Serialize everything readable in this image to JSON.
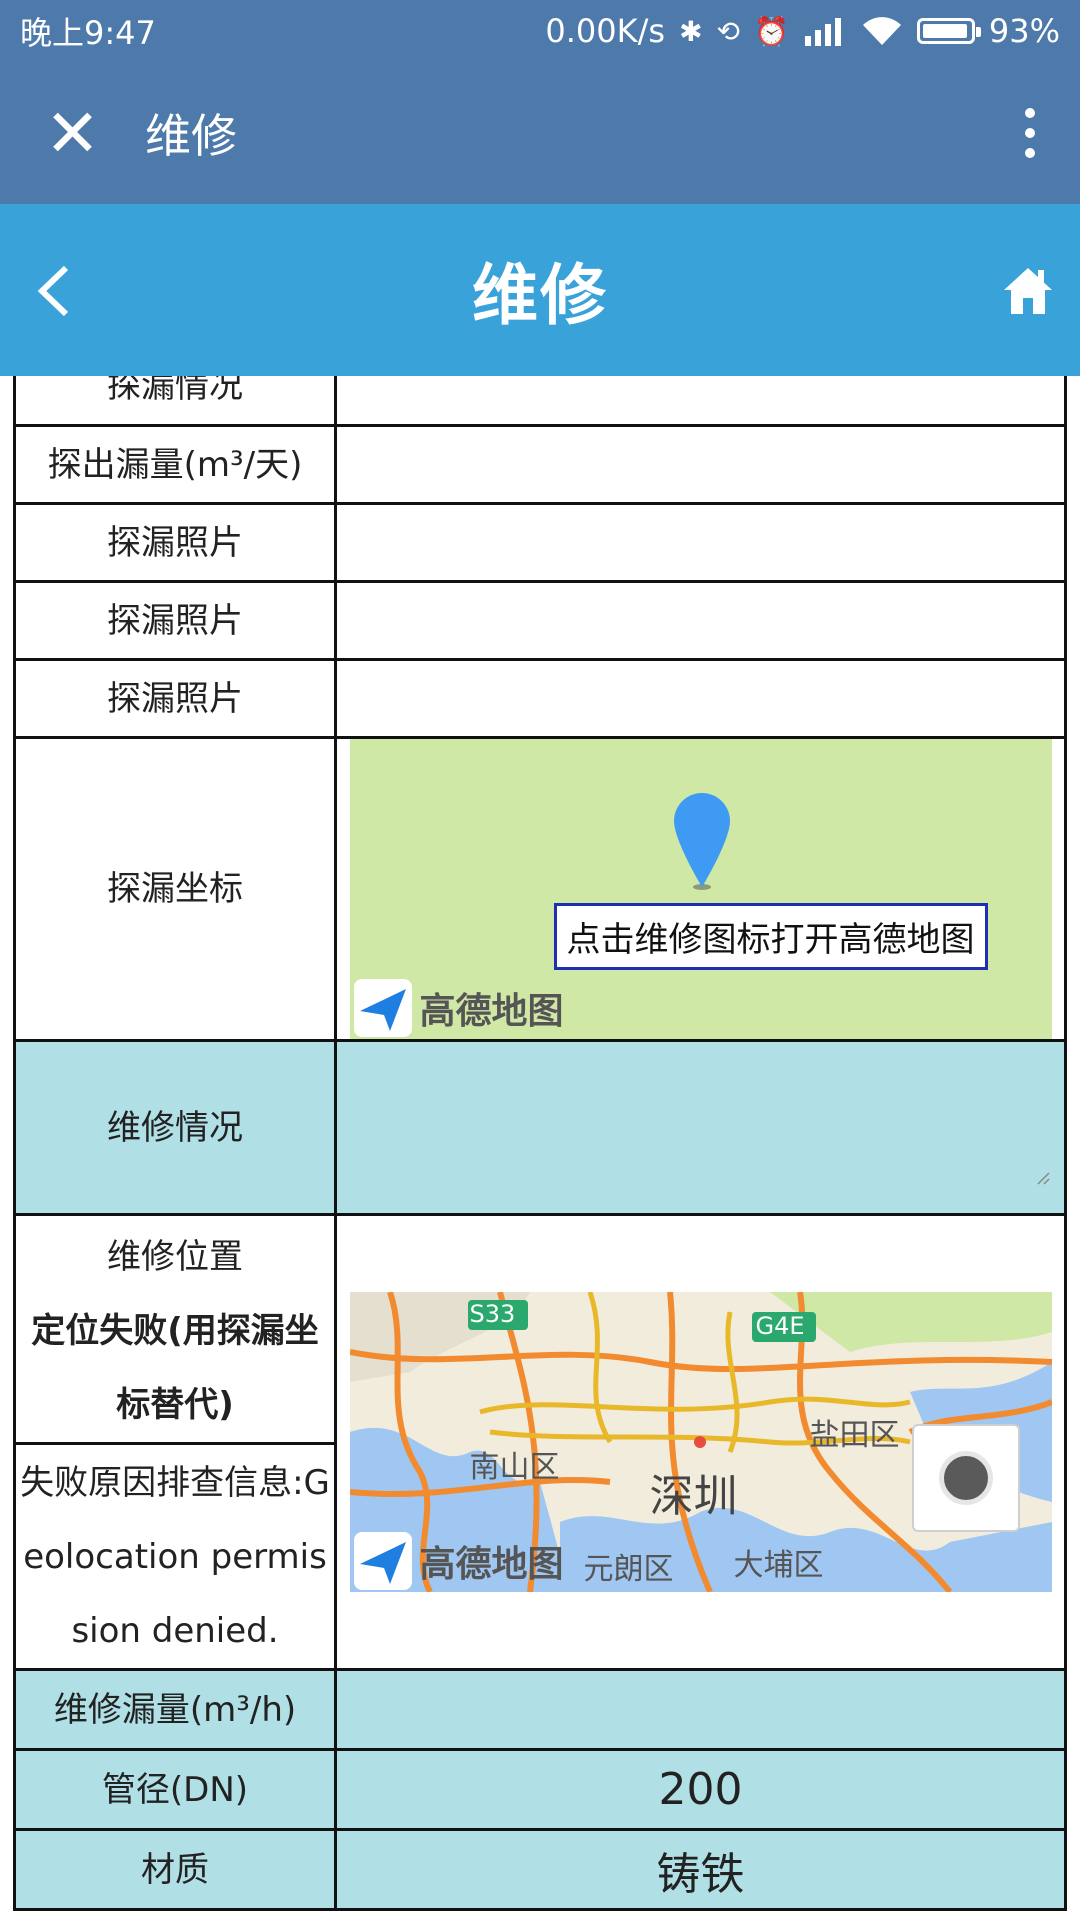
{
  "status_bar": {
    "time": "晚上9:47",
    "speed": "0.00K/s",
    "battery": "93%",
    "battery_level": 0.93,
    "icons": [
      "bluetooth-icon",
      "rotation-lock-icon",
      "alarm-icon",
      "signal-icon",
      "wifi-icon",
      "battery-icon"
    ]
  },
  "wx_nav": {
    "title": "维修",
    "close_icon": "close-icon",
    "more_icon": "more-vertical-icon"
  },
  "header": {
    "title": "维修",
    "back_icon": "chevron-left-icon",
    "home_icon": "home-icon"
  },
  "rows": {
    "detect_status": {
      "label": "探漏情况"
    },
    "detect_leak": {
      "label": "探出漏量(m³/天)",
      "value": ""
    },
    "photo1": {
      "label": "探漏照片"
    },
    "photo2": {
      "label": "探漏照片"
    },
    "photo3": {
      "label": "探漏照片"
    },
    "detect_coord": {
      "label": "探漏坐标",
      "map_hint": "点击维修图标打开高德地图",
      "map_logo": "高德地图"
    },
    "repair_status": {
      "label": "维修情况",
      "value": ""
    },
    "repair_location": {
      "label": "维修位置",
      "fail_text": "定位失败(用探漏坐标替代)",
      "fail_reason": "失败原因排查信息:Geolocation permission denied.",
      "map_logo": "高德地图",
      "map_labels": [
        "S33",
        "G4E",
        "盐田区",
        "南山区",
        "深圳",
        "元朗区",
        "大埔区"
      ]
    },
    "repair_leak": {
      "label": "维修漏量(m³/h)",
      "value": ""
    },
    "pipe_dn": {
      "label": "管径(DN)",
      "value": "200"
    },
    "material": {
      "label": "材质",
      "value": "铸铁"
    }
  },
  "colors": {
    "wx_bar": "#4e79ab",
    "header": "#39a2d9",
    "row_highlight": "#b0dfe5",
    "map_land": "#cfe8a5",
    "hint_border": "#1e2fb5"
  }
}
